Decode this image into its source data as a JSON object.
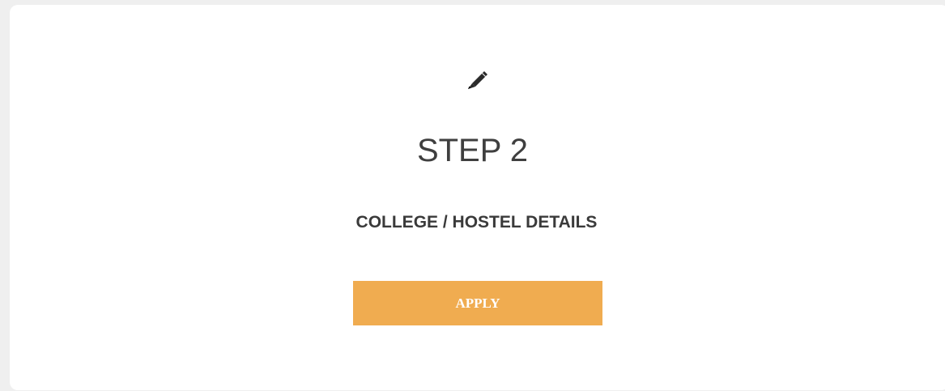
{
  "step": {
    "icon": "pencil-icon",
    "title": "STEP 2",
    "subtitle": "COLLEGE / HOSTEL DETAILS",
    "button_label": "APPLY"
  },
  "colors": {
    "page_background": "#efefef",
    "card_background": "#ffffff",
    "title_text": "#3f3f3f",
    "button_background": "#f0ac50",
    "button_text": "#ffffff"
  }
}
